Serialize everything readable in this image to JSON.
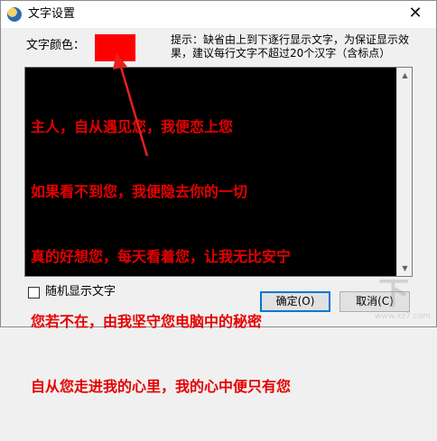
{
  "window": {
    "title": "文字设置",
    "close_glyph": "✕",
    "icon": "app-logo-icon"
  },
  "color_setting": {
    "label": "文字颜色：",
    "swatch_color": "#ff0000"
  },
  "hint": {
    "text": "提示：缺省由上到下逐行显示文字，为保证显示效果，建议每行文字不超过20个汉字（含标点）"
  },
  "text_area": {
    "text_color": "#e60000",
    "lines": [
      "主人，自从遇见您，我便恋上您",
      "如果看不到您，我便隐去你的一切",
      "真的好想您，每天看着您，让我无比安宁",
      "您若不在，由我坚守您电脑中的秘密",
      "自从您走进我的心里，我的心中便只有您"
    ]
  },
  "random_display": {
    "label": "随机显示文字",
    "checked": false
  },
  "buttons": {
    "ok": "确定(O)",
    "cancel": "取消(C)"
  },
  "annotation": {
    "arrow_color": "#e62020"
  },
  "watermark": {
    "text": "www.xz7.com"
  }
}
